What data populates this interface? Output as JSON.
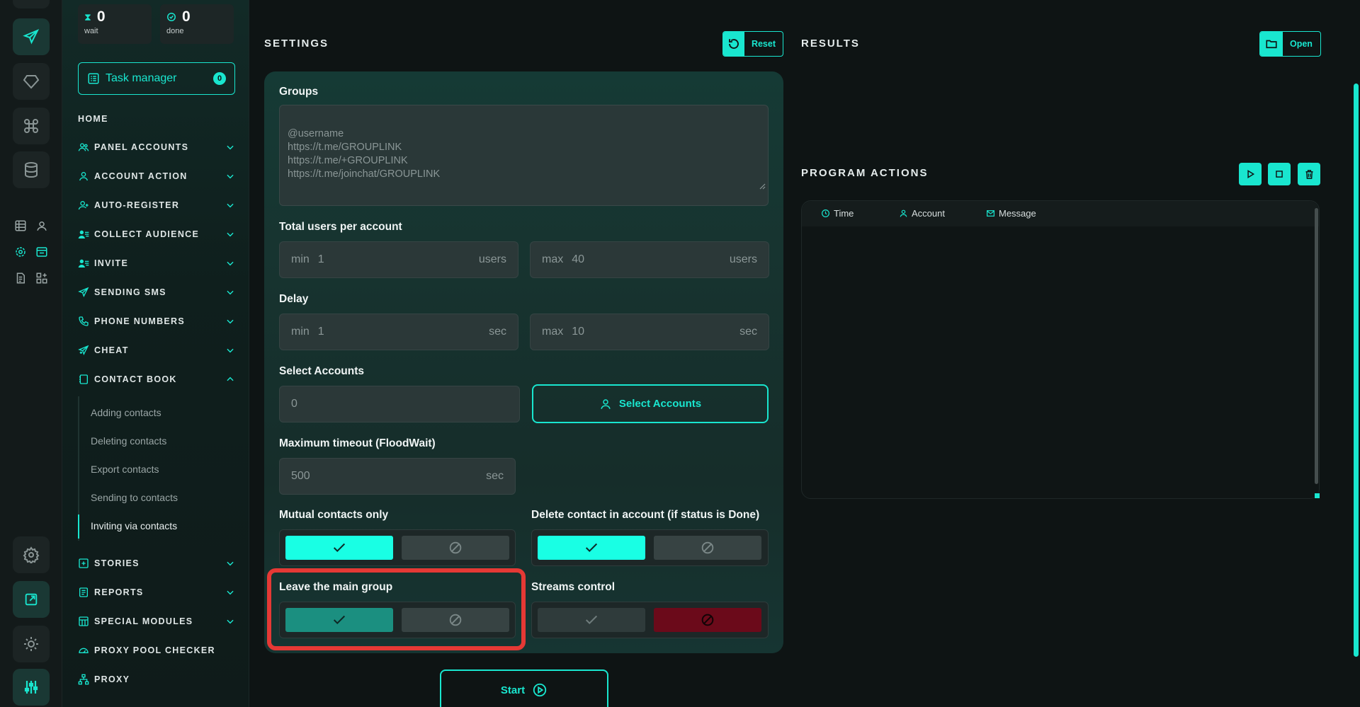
{
  "counters": {
    "wait": {
      "value": "0",
      "label": "wait",
      "icon": "hourglass-icon"
    },
    "done": {
      "value": "0",
      "label": "done",
      "icon": "check-circle-icon"
    }
  },
  "task_manager": {
    "label": "Task manager",
    "badge": "0"
  },
  "nav": {
    "home": "HOME",
    "items": [
      {
        "label": "PANEL ACCOUNTS",
        "icon": "users-icon"
      },
      {
        "label": "ACCOUNT ACTION",
        "icon": "user-icon"
      },
      {
        "label": "AUTO-REGISTER",
        "icon": "user-plus-icon"
      },
      {
        "label": "COLLECT AUDIENCE",
        "icon": "user-list-icon"
      },
      {
        "label": "INVITE",
        "icon": "user-list-icon"
      },
      {
        "label": "SENDING SMS",
        "icon": "send-icon"
      },
      {
        "label": "PHONE NUMBERS",
        "icon": "phone-icon"
      },
      {
        "label": "CHEAT",
        "icon": "send-plus-icon"
      },
      {
        "label": "CONTACT BOOK",
        "icon": "book-icon"
      },
      {
        "label": "STORIES",
        "icon": "plus-square-icon"
      },
      {
        "label": "REPORTS",
        "icon": "report-icon"
      },
      {
        "label": "SPECIAL MODULES",
        "icon": "grid-icon"
      },
      {
        "label": "PROXY POOL CHECKER",
        "icon": "gauge-icon"
      },
      {
        "label": "PROXY",
        "icon": "network-icon"
      }
    ],
    "contact_book_sub": [
      "Adding contacts",
      "Deleting contacts",
      "Export contacts",
      "Sending to contacts",
      "Inviting via contacts"
    ]
  },
  "settings": {
    "title": "SETTINGS",
    "reset_label": "Reset",
    "groups_label": "Groups",
    "groups_placeholder": "@username\nhttps://t.me/GROUPLINK\nhttps://t.me/+GROUPLINK\nhttps://t.me/joinchat/GROUPLINK",
    "total_users_label": "Total users per account",
    "users_min": {
      "prefix": "min",
      "value": "1",
      "unit": "users"
    },
    "users_max": {
      "prefix": "max",
      "value": "40",
      "unit": "users"
    },
    "delay_label": "Delay",
    "delay_min": {
      "prefix": "min",
      "value": "1",
      "unit": "sec"
    },
    "delay_max": {
      "prefix": "max",
      "value": "10",
      "unit": "sec"
    },
    "select_accounts_label": "Select Accounts",
    "selected_count": "0",
    "select_accounts_button": "Select Accounts",
    "max_timeout_label": "Maximum timeout (FloodWait)",
    "max_timeout": {
      "value": "500",
      "unit": "sec"
    },
    "mutual_contacts_label": "Mutual contacts only",
    "delete_contact_label": "Delete contact in account (if status is Done)",
    "leave_group_label": "Leave the main group",
    "streams_control_label": "Streams control",
    "start_label": "Start"
  },
  "results": {
    "title": "RESULTS",
    "open_label": "Open"
  },
  "program_actions": {
    "title": "PROGRAM ACTIONS",
    "columns": [
      {
        "label": "Time",
        "icon": "clock-icon"
      },
      {
        "label": "Account",
        "icon": "user-icon"
      },
      {
        "label": "Message",
        "icon": "mail-icon"
      }
    ]
  },
  "colors": {
    "accent": "#19e6cf",
    "highlight": "#e53935",
    "danger": "#6b0a1a"
  }
}
